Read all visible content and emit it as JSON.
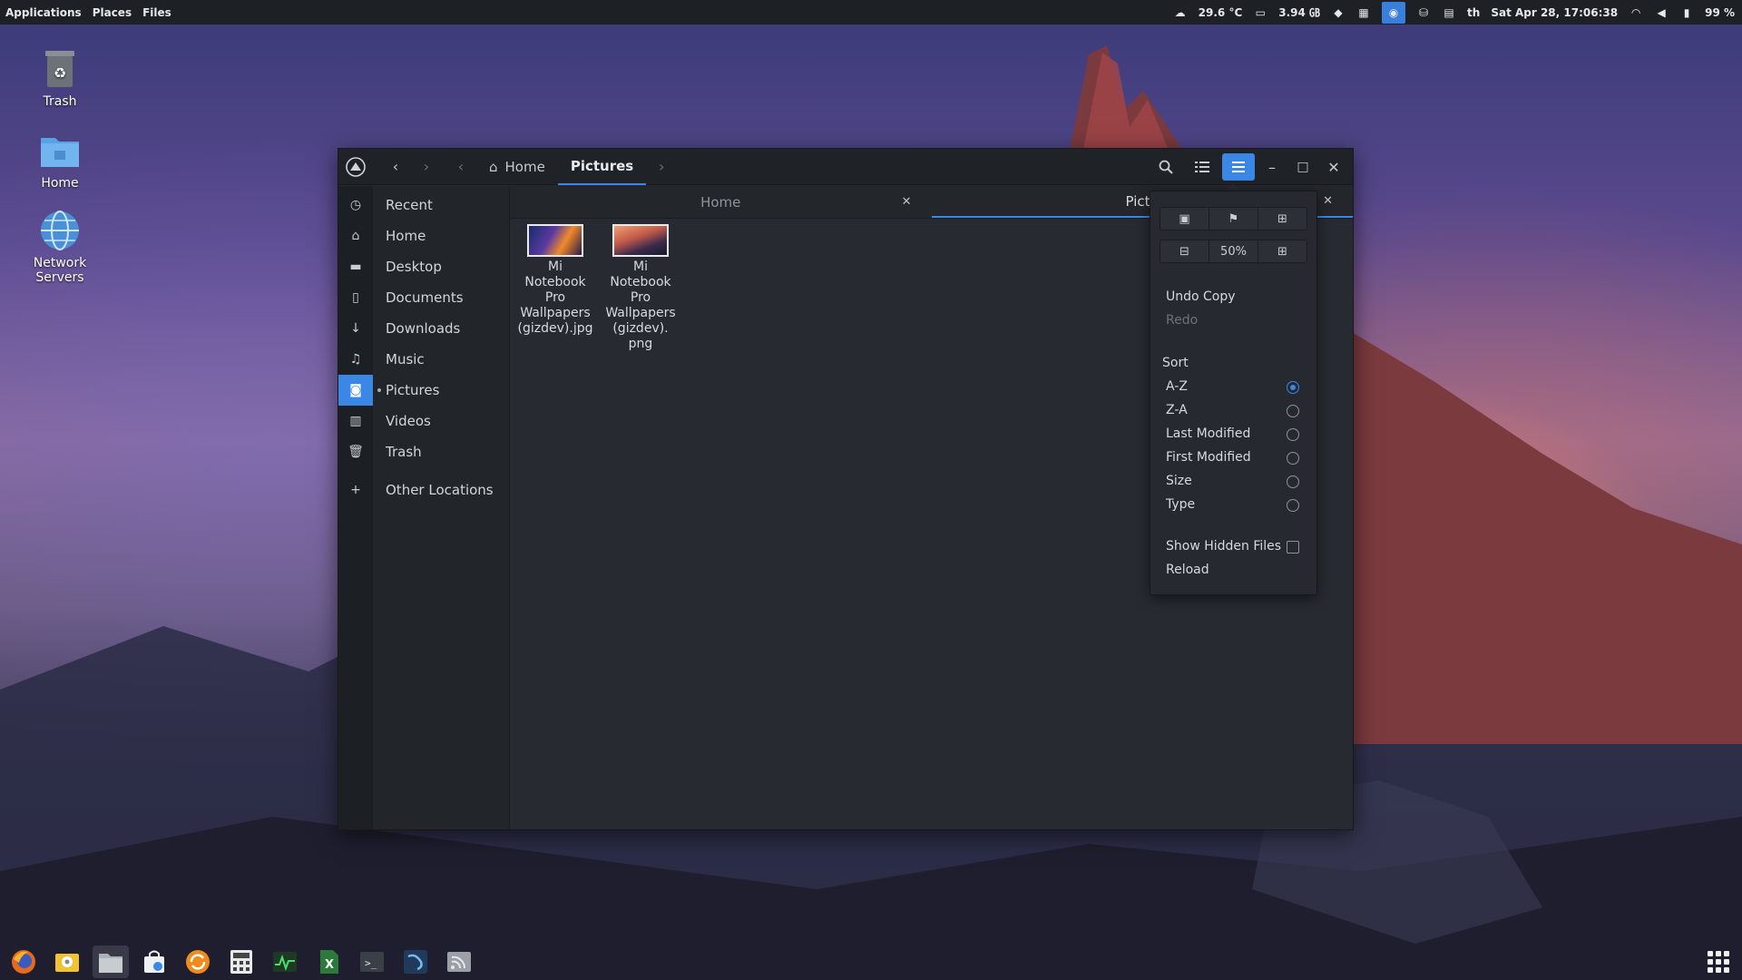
{
  "top_panel": {
    "menus": [
      "Applications",
      "Places",
      "Files"
    ],
    "weather": "29.6 °C",
    "disk": "3.94 ㎇",
    "keyboard_layout": "th",
    "clock": "Sat Apr 28, 17:06:38",
    "battery": "99 %",
    "tray_icons": [
      "cloud-icon",
      "display-icon",
      "dropbox-icon",
      "panel-icon",
      "screenshot-icon",
      "hdd-icon",
      "clipboard-icon",
      "wifi-icon",
      "volume-icon",
      "battery-icon"
    ]
  },
  "desktop": {
    "icons": [
      {
        "label": "Trash",
        "icon": "trash-icon"
      },
      {
        "label": "Home",
        "icon": "home-folder-icon"
      },
      {
        "label": "Network Servers",
        "icon": "network-icon"
      }
    ]
  },
  "window": {
    "breadcrumbs": [
      "Home",
      "Pictures"
    ],
    "sidebar": {
      "items": [
        {
          "label": "Recent",
          "icon": "clock-icon"
        },
        {
          "label": "Home",
          "icon": "home-icon"
        },
        {
          "label": "Desktop",
          "icon": "desktop-icon"
        },
        {
          "label": "Documents",
          "icon": "document-icon"
        },
        {
          "label": "Downloads",
          "icon": "download-icon"
        },
        {
          "label": "Music",
          "icon": "music-icon"
        },
        {
          "label": "Pictures",
          "icon": "camera-icon"
        },
        {
          "label": "Videos",
          "icon": "film-icon"
        },
        {
          "label": "Trash",
          "icon": "trash-icon"
        }
      ],
      "other_locations": "Other Locations",
      "active": "Pictures"
    },
    "tabs": [
      {
        "label": "Home"
      },
      {
        "label": "Pictu"
      }
    ],
    "files": [
      {
        "name": "Mi Notebook Pro Wallpapers (gizdev).jpg",
        "lines": [
          "Mi",
          "Notebook",
          "Pro",
          "Wallpapers",
          "(gizdev).jpg"
        ]
      },
      {
        "name": "Mi Notebook Pro Wallpapers (gizdev).png",
        "lines": [
          "Mi",
          "Notebook",
          "Pro",
          "Wallpapers",
          "(gizdev).",
          "png"
        ]
      }
    ]
  },
  "menu_popover": {
    "zoom": "50%",
    "undo": "Undo Copy",
    "redo": "Redo",
    "sort_header": "Sort",
    "sort_options": [
      "A-Z",
      "Z-A",
      "Last Modified",
      "First Modified",
      "Size",
      "Type"
    ],
    "sort_selected": "A-Z",
    "show_hidden": "Show Hidden Files",
    "show_hidden_checked": false,
    "reload": "Reload"
  },
  "dock": {
    "items": [
      "firefox-icon",
      "mail-icon",
      "files-icon",
      "store-icon",
      "update-icon",
      "calculator-icon",
      "system-monitor-icon",
      "spreadsheet-icon",
      "terminal-icon",
      "ide-icon",
      "rss-icon"
    ],
    "active": "files-icon"
  },
  "colors": {
    "accent": "#3a87e6",
    "panel": "#1d2024",
    "window": "#272b31"
  }
}
